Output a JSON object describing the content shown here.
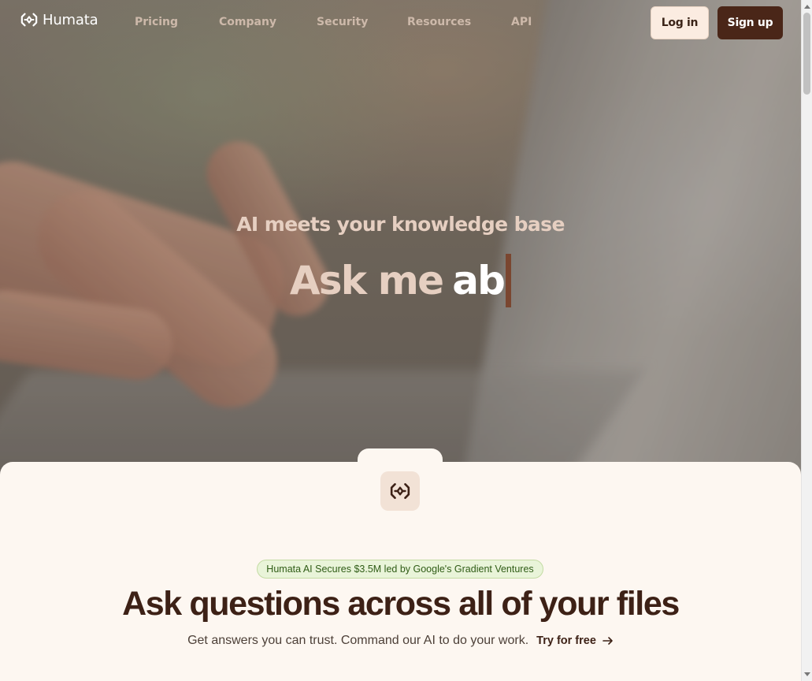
{
  "nav": {
    "brand": "Humata",
    "links": [
      "Pricing",
      "Company",
      "Security",
      "Resources",
      "API"
    ],
    "login_label": "Log in",
    "signup_label": "Sign up"
  },
  "hero": {
    "kicker": "AI meets your knowledge base",
    "ask_prefix": "Ask me",
    "ask_typed": "ab"
  },
  "main": {
    "badge": "Humata AI Secures $3.5M led by Google's Gradient Ventures",
    "headline": "Ask questions across all of your files",
    "subline": "Get answers you can trust. Command our AI to do your work.",
    "cta": "Try for free",
    "cta_icon": "arrow-right-icon"
  },
  "colors": {
    "brand_dark": "#4a2618",
    "brand_light": "#fbece1",
    "background": "#fdf7f1",
    "badge_bg": "#e9f4d9",
    "badge_text": "#2f5c16"
  }
}
